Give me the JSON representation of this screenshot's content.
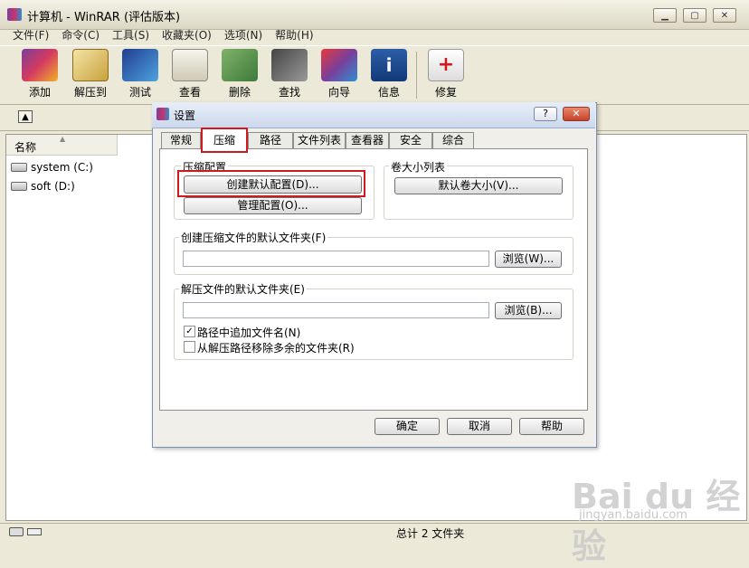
{
  "window": {
    "title": "计算机 - WinRAR (评估版本)"
  },
  "menubar": {
    "items": [
      "文件(F)",
      "命令(C)",
      "工具(S)",
      "收藏夹(O)",
      "选项(N)",
      "帮助(H)"
    ]
  },
  "toolbar": {
    "buttons": [
      {
        "label": "添加",
        "icon": "add-archive-icon"
      },
      {
        "label": "解压到",
        "icon": "extract-icon"
      },
      {
        "label": "测试",
        "icon": "test-icon"
      },
      {
        "label": "查看",
        "icon": "view-icon"
      },
      {
        "label": "删除",
        "icon": "delete-icon"
      },
      {
        "label": "查找",
        "icon": "find-icon"
      },
      {
        "label": "向导",
        "icon": "wizard-icon"
      },
      {
        "label": "信息",
        "icon": "info-icon"
      },
      {
        "label": "修复",
        "icon": "repair-icon"
      }
    ]
  },
  "filelist": {
    "column_name": "名称",
    "drives": [
      "system (C:)",
      "soft (D:)"
    ]
  },
  "statusbar": {
    "text": "总计 2 文件夹"
  },
  "dialog": {
    "title": "设置",
    "tabs": [
      "常规",
      "压缩",
      "路径",
      "文件列表",
      "查看器",
      "安全",
      "综合"
    ],
    "active_tab": "压缩",
    "compression_group": {
      "title": "压缩配置",
      "create_default_btn": "创建默认配置(D)...",
      "manage_btn": "管理配置(O)..."
    },
    "volume_group": {
      "title": "卷大小列表",
      "default_volume_btn": "默认卷大小(V)..."
    },
    "archive_folder": {
      "label": "创建压缩文件的默认文件夹(F)",
      "value": "",
      "browse_btn": "浏览(W)..."
    },
    "extract_folder": {
      "label": "解压文件的默认文件夹(E)",
      "value": "",
      "browse_btn": "浏览(B)...",
      "append_name": {
        "label": "路径中追加文件名(N)",
        "checked": true
      },
      "remove_redundant": {
        "label": "从解压路径移除多余的文件夹(R)",
        "checked": false
      }
    },
    "buttons": {
      "ok": "确定",
      "cancel": "取消",
      "help": "帮助"
    }
  },
  "watermark": {
    "brand": "Bai du 经验",
    "url": "jingyan.baidu.com"
  },
  "colors": {
    "highlight": "#d0181f",
    "dialog_title": "#ccd8ec"
  }
}
